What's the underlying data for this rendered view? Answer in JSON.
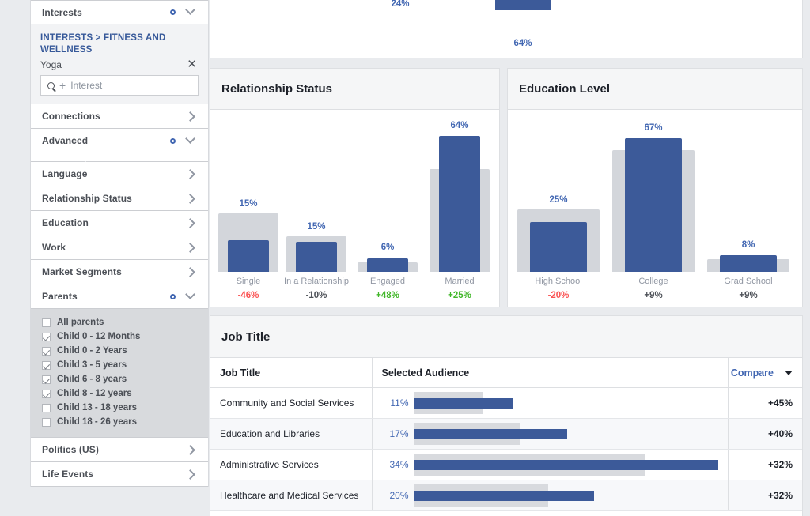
{
  "sidebar": {
    "interests_section": {
      "label": "Interests",
      "breadcrumb": "INTERESTS > FITNESS AND WELLNESS",
      "selected_interest": "Yoga",
      "search_placeholder": "Interest"
    },
    "items": [
      {
        "label": "Connections",
        "state": "collapsed"
      },
      {
        "label": "Advanced",
        "state": "expanded"
      },
      {
        "label": "Language",
        "state": "collapsed"
      },
      {
        "label": "Relationship Status",
        "state": "collapsed"
      },
      {
        "label": "Education",
        "state": "collapsed"
      },
      {
        "label": "Work",
        "state": "collapsed"
      },
      {
        "label": "Market Segments",
        "state": "collapsed"
      },
      {
        "label": "Parents",
        "state": "expanded"
      }
    ],
    "parents_options": [
      {
        "label": "All parents",
        "checked": false
      },
      {
        "label": "Child 0 - 12 Months",
        "checked": true
      },
      {
        "label": "Child 0 - 2 Years",
        "checked": true
      },
      {
        "label": "Child 3 - 5 years",
        "checked": true
      },
      {
        "label": "Child 6 - 8 years",
        "checked": true
      },
      {
        "label": "Child 8 - 12 years",
        "checked": true
      },
      {
        "label": "Child 13 - 18 years",
        "checked": false
      },
      {
        "label": "Child 18 - 26 years",
        "checked": false
      }
    ],
    "footer_items": [
      {
        "label": "Politics (US)",
        "state": "collapsed"
      },
      {
        "label": "Life Events",
        "state": "collapsed"
      }
    ]
  },
  "colors": {
    "selected_bar": "#3c5a99",
    "compare_bar": "#d3d6db",
    "value_label": "#4267b2",
    "positive": "#42b72a",
    "negative": "#fa5252"
  },
  "top_card": {
    "partial_labels": [
      "24%",
      "64%"
    ]
  },
  "chart_data": [
    {
      "type": "bar",
      "title": "Relationship Status",
      "xlabel": "",
      "ylabel": "",
      "ylim": [
        0,
        75
      ],
      "grid": false,
      "legend": "none",
      "categories": [
        "Single",
        "In a Relationship",
        "Engaged",
        "Married"
      ],
      "series": [
        {
          "name": "Selected Audience",
          "values": [
            15,
            15,
            6,
            64
          ],
          "color": "#3c5a99"
        },
        {
          "name": "Compare",
          "values": [
            28,
            17,
            7,
            51
          ],
          "color": "#d3d6db"
        }
      ],
      "value_labels": [
        "15%",
        "15%",
        "6%",
        "64%"
      ],
      "deltas": [
        "-46%",
        "-10%",
        "+48%",
        "+25%"
      ],
      "delta_signs": [
        "neg",
        "neu",
        "pos",
        "pos"
      ]
    },
    {
      "type": "bar",
      "title": "Education Level",
      "xlabel": "",
      "ylabel": "",
      "ylim": [
        0,
        75
      ],
      "grid": false,
      "legend": "none",
      "categories": [
        "High School",
        "College",
        "Grad School"
      ],
      "series": [
        {
          "name": "Selected Audience",
          "values": [
            25,
            67,
            8
          ],
          "color": "#3c5a99"
        },
        {
          "name": "Compare",
          "values": [
            31,
            61,
            7
          ],
          "color": "#d3d6db"
        }
      ],
      "value_labels": [
        "25%",
        "67%",
        "8%"
      ],
      "deltas": [
        "-20%",
        "+9%",
        "+9%"
      ],
      "delta_signs": [
        "neg",
        "neu",
        "neu"
      ]
    },
    {
      "type": "table",
      "title": "Job Title",
      "columns": [
        "Job Title",
        "Selected Audience",
        "Compare"
      ],
      "rows": [
        {
          "job_title": "Community and Social Services",
          "percent": "11%",
          "selected": 11,
          "compare": 7.7,
          "delta": "+45%"
        },
        {
          "job_title": "Education and Libraries",
          "percent": "17%",
          "selected": 17,
          "compare": 11.8,
          "delta": "+40%"
        },
        {
          "job_title": "Administrative Services",
          "percent": "34%",
          "selected": 34,
          "compare": 25.8,
          "delta": "+32%"
        },
        {
          "job_title": "Healthcare and Medical Services",
          "percent": "20%",
          "selected": 20,
          "compare": 15.0,
          "delta": "+32%"
        }
      ]
    }
  ]
}
